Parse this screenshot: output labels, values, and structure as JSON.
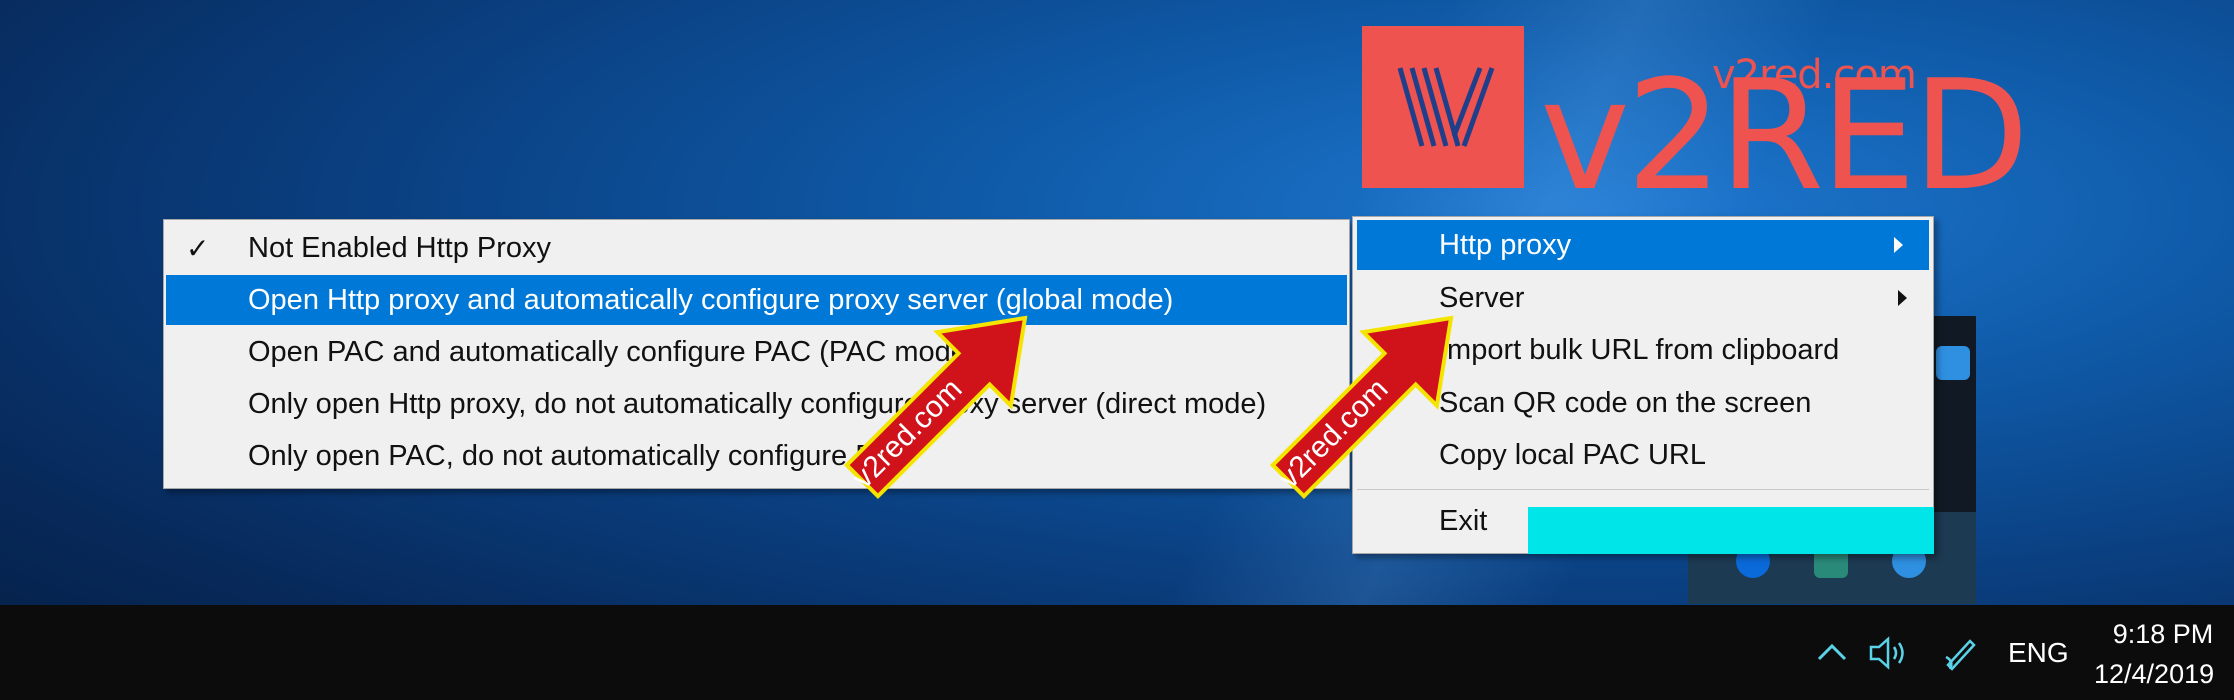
{
  "logo": {
    "small_text": "v2red.com",
    "big_text": "v2RED",
    "color": "#ef5350"
  },
  "proxy_submenu": {
    "items": [
      {
        "label": "Not Enabled Http Proxy",
        "checked": true,
        "highlighted": false
      },
      {
        "label": "Open Http proxy and automatically configure proxy server (global mode)",
        "checked": false,
        "highlighted": true
      },
      {
        "label": "Open PAC and automatically configure PAC (PAC mode)",
        "checked": false,
        "highlighted": false
      },
      {
        "label": "Only open Http proxy, do not automatically configure proxy server (direct mode)",
        "checked": false,
        "highlighted": false
      },
      {
        "label": "Only open PAC, do not automatically configure PAC",
        "checked": false,
        "highlighted": false
      }
    ],
    "check_glyph": "✓"
  },
  "tray_menu": {
    "items": [
      {
        "label": "Http proxy",
        "has_submenu": true,
        "highlighted": true
      },
      {
        "label": "Server",
        "has_submenu": true,
        "highlighted": false
      },
      {
        "label": "Import bulk URL from clipboard",
        "has_submenu": false,
        "highlighted": false
      },
      {
        "label": "Scan QR code on the screen",
        "has_submenu": false,
        "highlighted": false
      },
      {
        "label": "Copy local PAC URL",
        "has_submenu": false,
        "highlighted": false
      },
      {
        "label": "Exit",
        "has_submenu": false,
        "highlighted": false
      }
    ]
  },
  "watermarks": [
    {
      "text": "v2red.com"
    },
    {
      "text": "v2red.com"
    }
  ],
  "taskbar": {
    "chevron_icon": "chevron-up-icon",
    "volume_icon": "speaker-icon",
    "pen_icon": "pen-icon",
    "language": "ENG",
    "time": "9:18 PM",
    "date": "12/4/2019"
  },
  "colors": {
    "accent": "#0078d7",
    "menu_bg": "#f0f0f0",
    "taskbar_bg": "#0c0c0c",
    "watermark_fill": "#d0121b",
    "watermark_border": "#f5e400",
    "cyan_block": "#00e5e8"
  }
}
